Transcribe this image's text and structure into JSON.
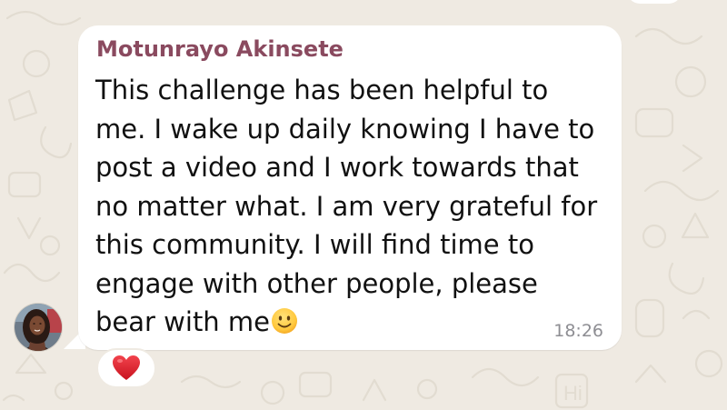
{
  "chat": {
    "background_color": "#EFEAE2",
    "bubble_color": "#FFFFFF"
  },
  "message": {
    "sender": "Motunrayo Akinsete",
    "sender_color": "#8A4A5F",
    "lines": [
      "This challenge has been helpful to",
      "me. I wake up daily knowing I have to",
      "post a video and I work towards that",
      "no matter what. I am very grateful for",
      "this community. I will find time to",
      "engage with other people, please",
      "bear with me"
    ],
    "trailing_emoji": "slightly-smiling-face",
    "time": "18:26"
  },
  "avatar": {
    "icon": "profile-photo"
  },
  "reaction": {
    "emoji": "red-heart",
    "color": "#E0242F"
  }
}
